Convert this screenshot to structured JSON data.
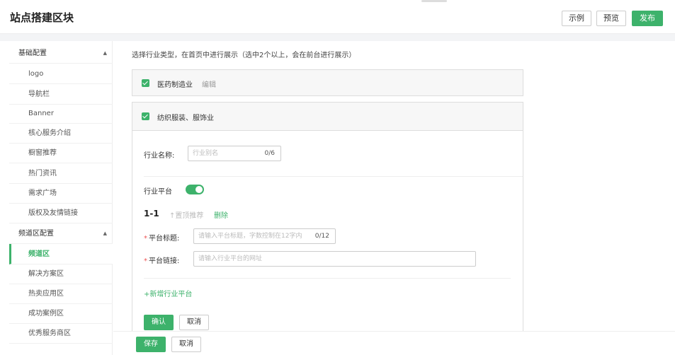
{
  "header": {
    "title": "站点搭建区块",
    "example_label": "示例",
    "preview_label": "预览",
    "publish_label": "发布"
  },
  "sidebar": {
    "groups": [
      {
        "label": "基础配置",
        "items": [
          "logo",
          "导航栏",
          "Banner",
          "核心服务介绍",
          "橱窗推荐",
          "热门资讯",
          "需求广场",
          "版权及友情链接"
        ]
      },
      {
        "label": "频道区配置",
        "items": [
          "频道区",
          "解决方案区",
          "热卖应用区",
          "成功案例区",
          "优秀服务商区"
        ]
      }
    ],
    "active_item": "频道区"
  },
  "main": {
    "hint": "选择行业类型，在首页中进行展示（选中2个以上，会在前台进行展示）",
    "industry1": {
      "label": "医药制造业",
      "edit_label": "编辑",
      "checked": true
    },
    "industry2": {
      "label": "纺织服装、服饰业",
      "checked": true
    },
    "form": {
      "name_label": "行业名称:",
      "name_placeholder": "行业别名",
      "name_count": "0/6",
      "platform_label": "行业平台",
      "platform_enabled": true,
      "entry_index": "1-1",
      "top_label": "↑置顶推荐",
      "delete_label": "删除",
      "title_label": "平台标题:",
      "title_placeholder": "请输入平台标题，字数控制在12字内",
      "title_count": "0/12",
      "link_label": "平台链接:",
      "link_placeholder": "请输入行业平台的网址",
      "required_mark": "*",
      "add_label": "+新增行业平台",
      "confirm_label": "确认",
      "cancel_label": "取消"
    }
  },
  "footer": {
    "save_label": "保存",
    "cancel_label": "取消"
  },
  "colors": {
    "accent": "#3db26b",
    "required": "#e55555"
  }
}
